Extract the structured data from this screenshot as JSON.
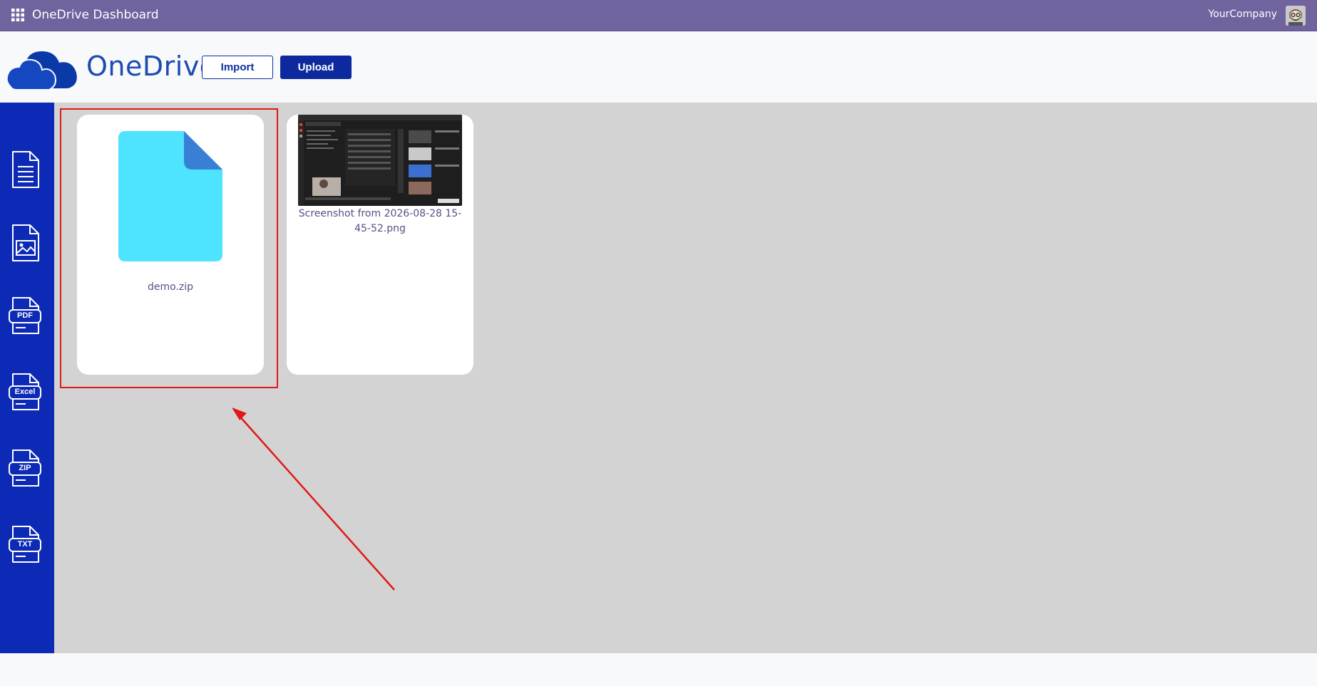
{
  "navbar": {
    "title": "OneDrive Dashboard",
    "company": "YourCompany",
    "icons": {
      "apps": "grid-icon",
      "user": "avatar"
    }
  },
  "header": {
    "logo_text": "OneDrive",
    "import_label": "Import",
    "upload_label": "Upload"
  },
  "sidebar": {
    "items": [
      {
        "name": "document",
        "label": ""
      },
      {
        "name": "image",
        "label": ""
      },
      {
        "name": "pdf",
        "label": "PDF"
      },
      {
        "name": "excel",
        "label": "Excel"
      },
      {
        "name": "zip",
        "label": "ZIP"
      },
      {
        "name": "txt",
        "label": "TXT"
      }
    ]
  },
  "files": [
    {
      "name": "demo.zip",
      "type": "zip"
    },
    {
      "name": "Screenshot from 2026-08-28 15-45-52.png",
      "type": "image"
    }
  ],
  "colors": {
    "navbar": "#71639e",
    "sidebar": "#0c2ab5",
    "primary": "#0c2a9e",
    "file_icon": "#4ee3ff",
    "highlight": "#e01818"
  }
}
